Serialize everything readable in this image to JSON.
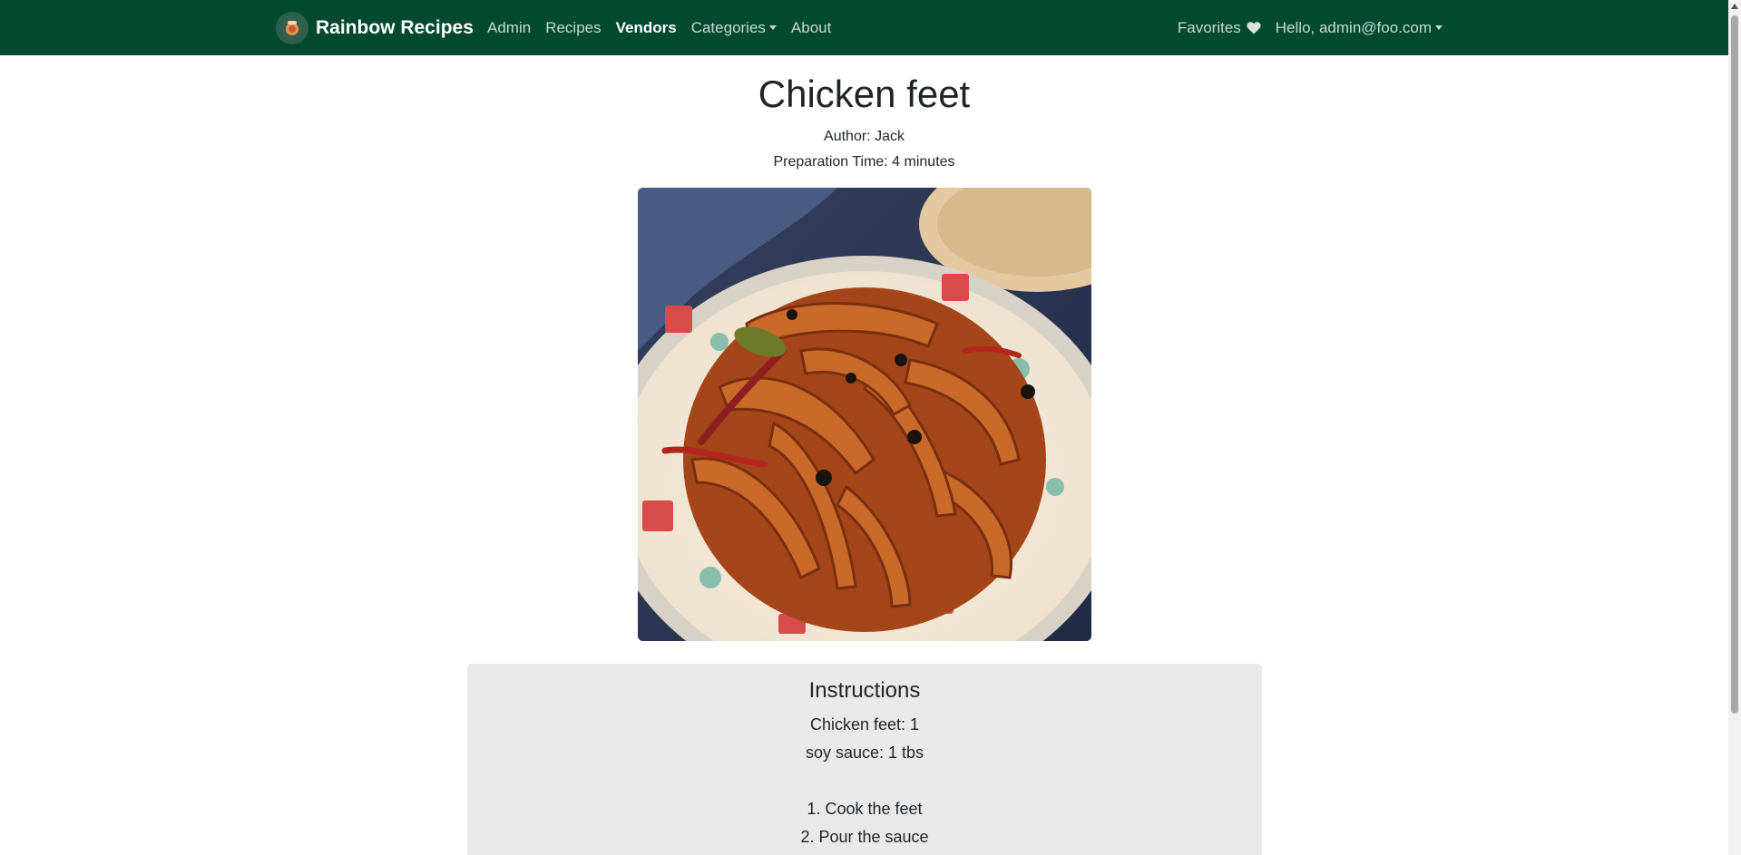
{
  "navbar": {
    "brand": "Rainbow Recipes",
    "links": [
      {
        "label": "Admin"
      },
      {
        "label": "Recipes"
      },
      {
        "label": "Vendors"
      },
      {
        "label": "Categories"
      },
      {
        "label": "About"
      }
    ],
    "favorites": "Favorites",
    "user_menu": "Hello, admin@foo.com"
  },
  "recipe": {
    "title": "Chicken feet",
    "author": "Author: Jack",
    "prep_time": "Preparation Time: 4 minutes",
    "image_icon": "chicken-feet-photo"
  },
  "instructions": {
    "heading": "Instructions",
    "lines": [
      "Chicken feet: 1",
      "soy sauce: 1 tbs",
      "",
      "1. Cook the feet",
      "2. Pour the sauce"
    ]
  },
  "colors": {
    "navbar_bg": "#024930",
    "instructions_bg": "#e9e9e9"
  }
}
